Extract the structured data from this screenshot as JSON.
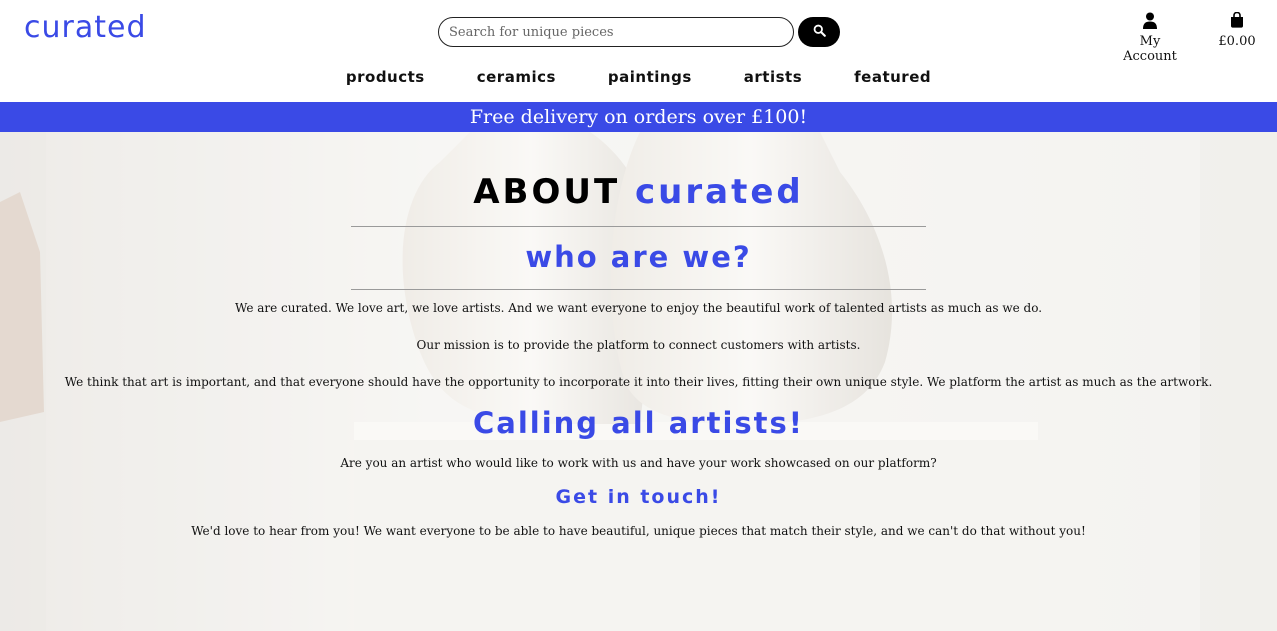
{
  "header": {
    "logo": "curated",
    "search_placeholder": "Search for unique pieces",
    "account_label": "My Account",
    "cart_total": "£0.00"
  },
  "nav": {
    "items": [
      "Products",
      "Ceramics",
      "Paintings",
      "Artists",
      "Featured"
    ]
  },
  "banner": {
    "text": "Free delivery on orders over £100!"
  },
  "about": {
    "title_prefix": "About",
    "title_brand": "curated",
    "who_heading": "who are we?",
    "paragraph_1": "We are curated. We love art, we love artists. And we want everyone to enjoy the beautiful work of talented artists as much as we do.",
    "paragraph_2": "Our mission is to provide the platform to connect customers with artists.",
    "paragraph_3": "We think that art is important, and that everyone should have the opportunity to incorporate it into their lives, fitting their own unique style. We platform the artist as much as the artwork.",
    "calling_heading": "Calling all artists!",
    "artist_question": "Are you an artist who would like to work with us and have your work showcased on our platform?",
    "get_in_touch": "Get in touch!",
    "closing": "We'd love to hear from you! We want everyone to be able to have beautiful, unique pieces that match their style, and we can't do that without you!"
  },
  "colors": {
    "brand_blue": "#3a4ae6",
    "black": "#000000"
  },
  "icons": [
    "search-icon",
    "user-icon",
    "shopping-bag-icon"
  ]
}
